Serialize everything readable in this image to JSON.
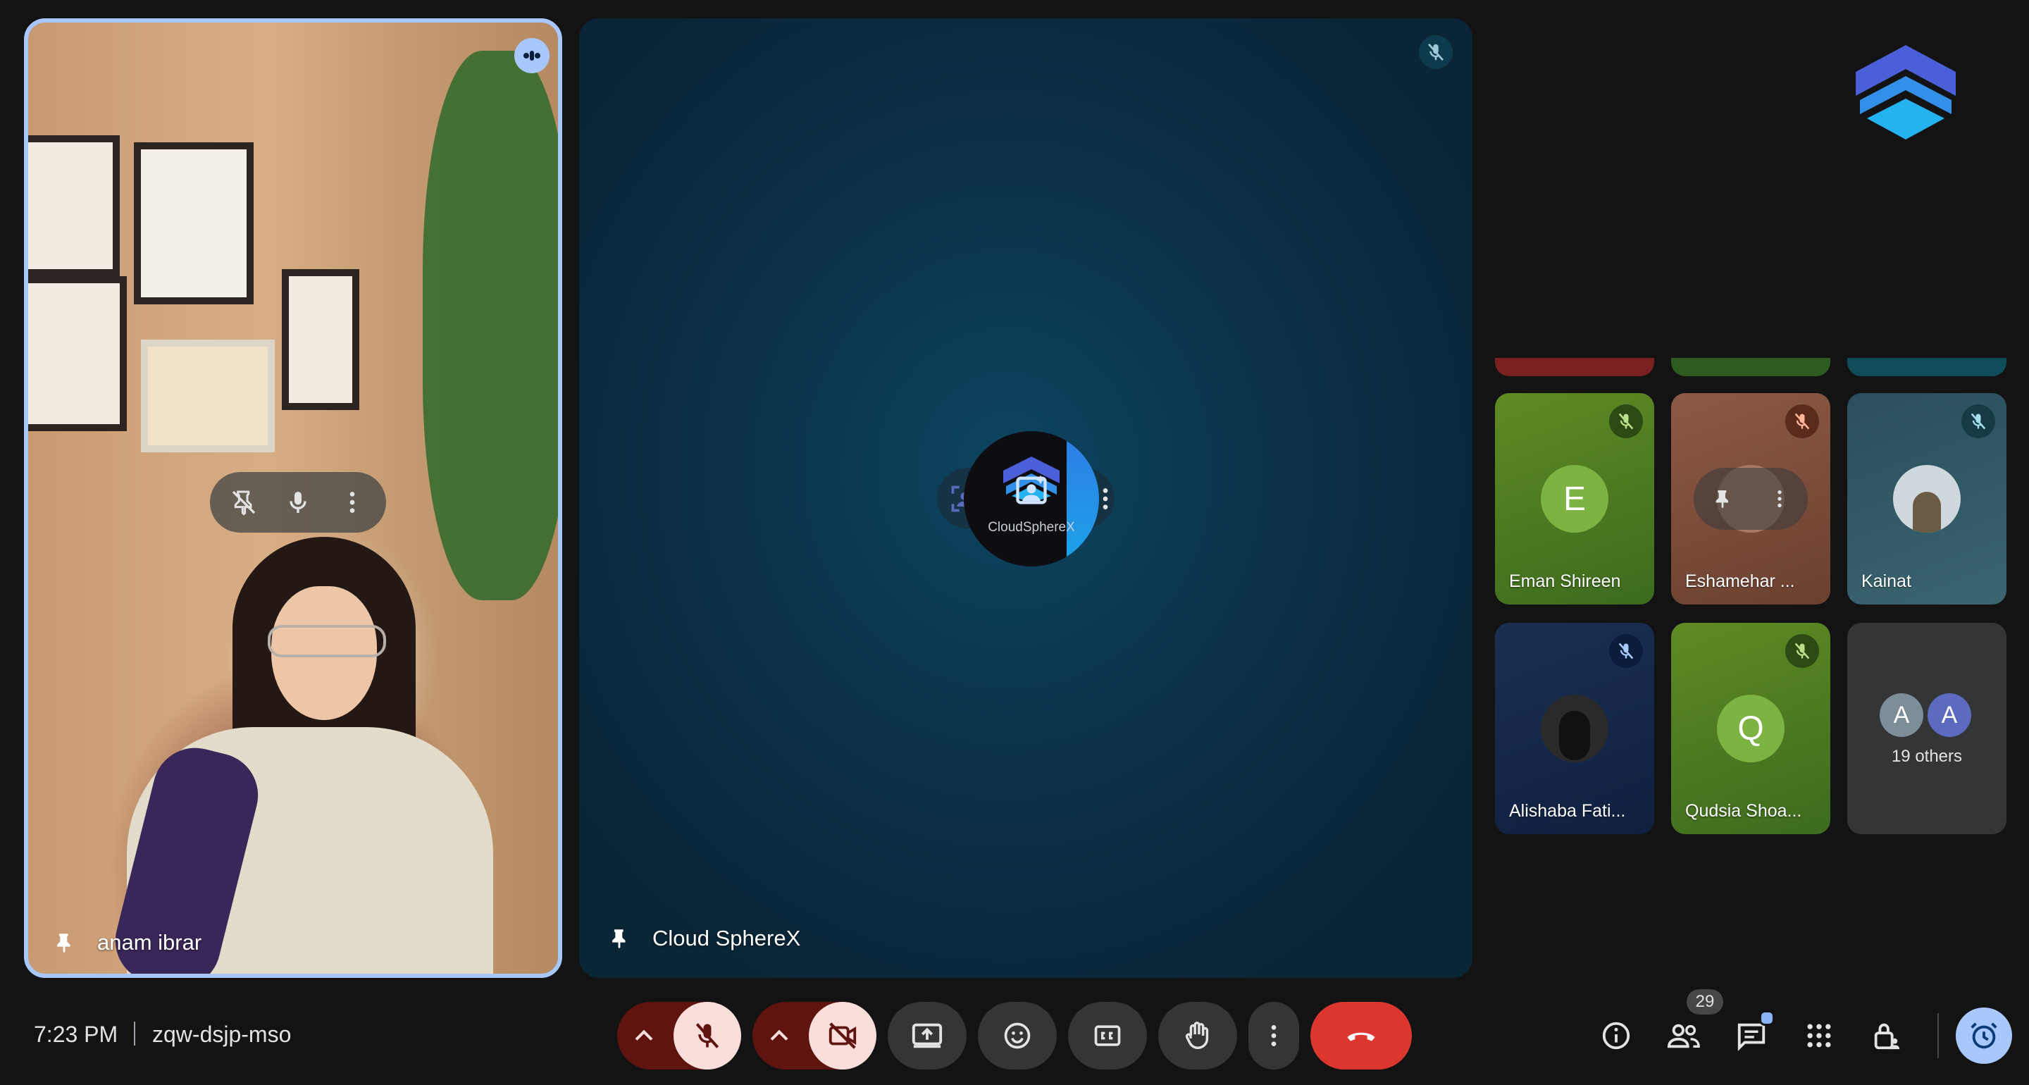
{
  "colors": {
    "accent": "#a8c7fa",
    "end_call": "#dc362e",
    "muted_bg": "#f9dedc",
    "muted_dark": "#601410",
    "background": "#131314"
  },
  "main_speaker": {
    "name": "anam ibrar",
    "speaking": true
  },
  "center_tile": {
    "name": "Cloud SphereX",
    "logo_text": "CloudSphereX",
    "muted": true
  },
  "grid": {
    "participants": [
      {
        "name": "Eman Shireen",
        "initial": "E",
        "muted": true
      },
      {
        "name": "Eshamehar ...",
        "muted": true
      },
      {
        "name": "Kainat",
        "muted": true
      },
      {
        "name": "Alishaba Fati...",
        "muted": true
      },
      {
        "name": "Qudsia Shoa...",
        "initial": "Q",
        "muted": true
      }
    ],
    "others": {
      "label": "19 others",
      "avatars": [
        "A",
        "A"
      ]
    }
  },
  "bottom_bar": {
    "time": "7:23 PM",
    "meeting_code": "zqw-dsjp-mso",
    "participant_count": "29",
    "controls": [
      "mic-options",
      "mic-off",
      "camera-options",
      "camera-off",
      "present",
      "emoji",
      "captions",
      "raise-hand",
      "more-options",
      "leave-call"
    ],
    "right_controls": [
      "meeting-details",
      "people",
      "chat",
      "activities",
      "host-controls",
      "timer"
    ]
  }
}
